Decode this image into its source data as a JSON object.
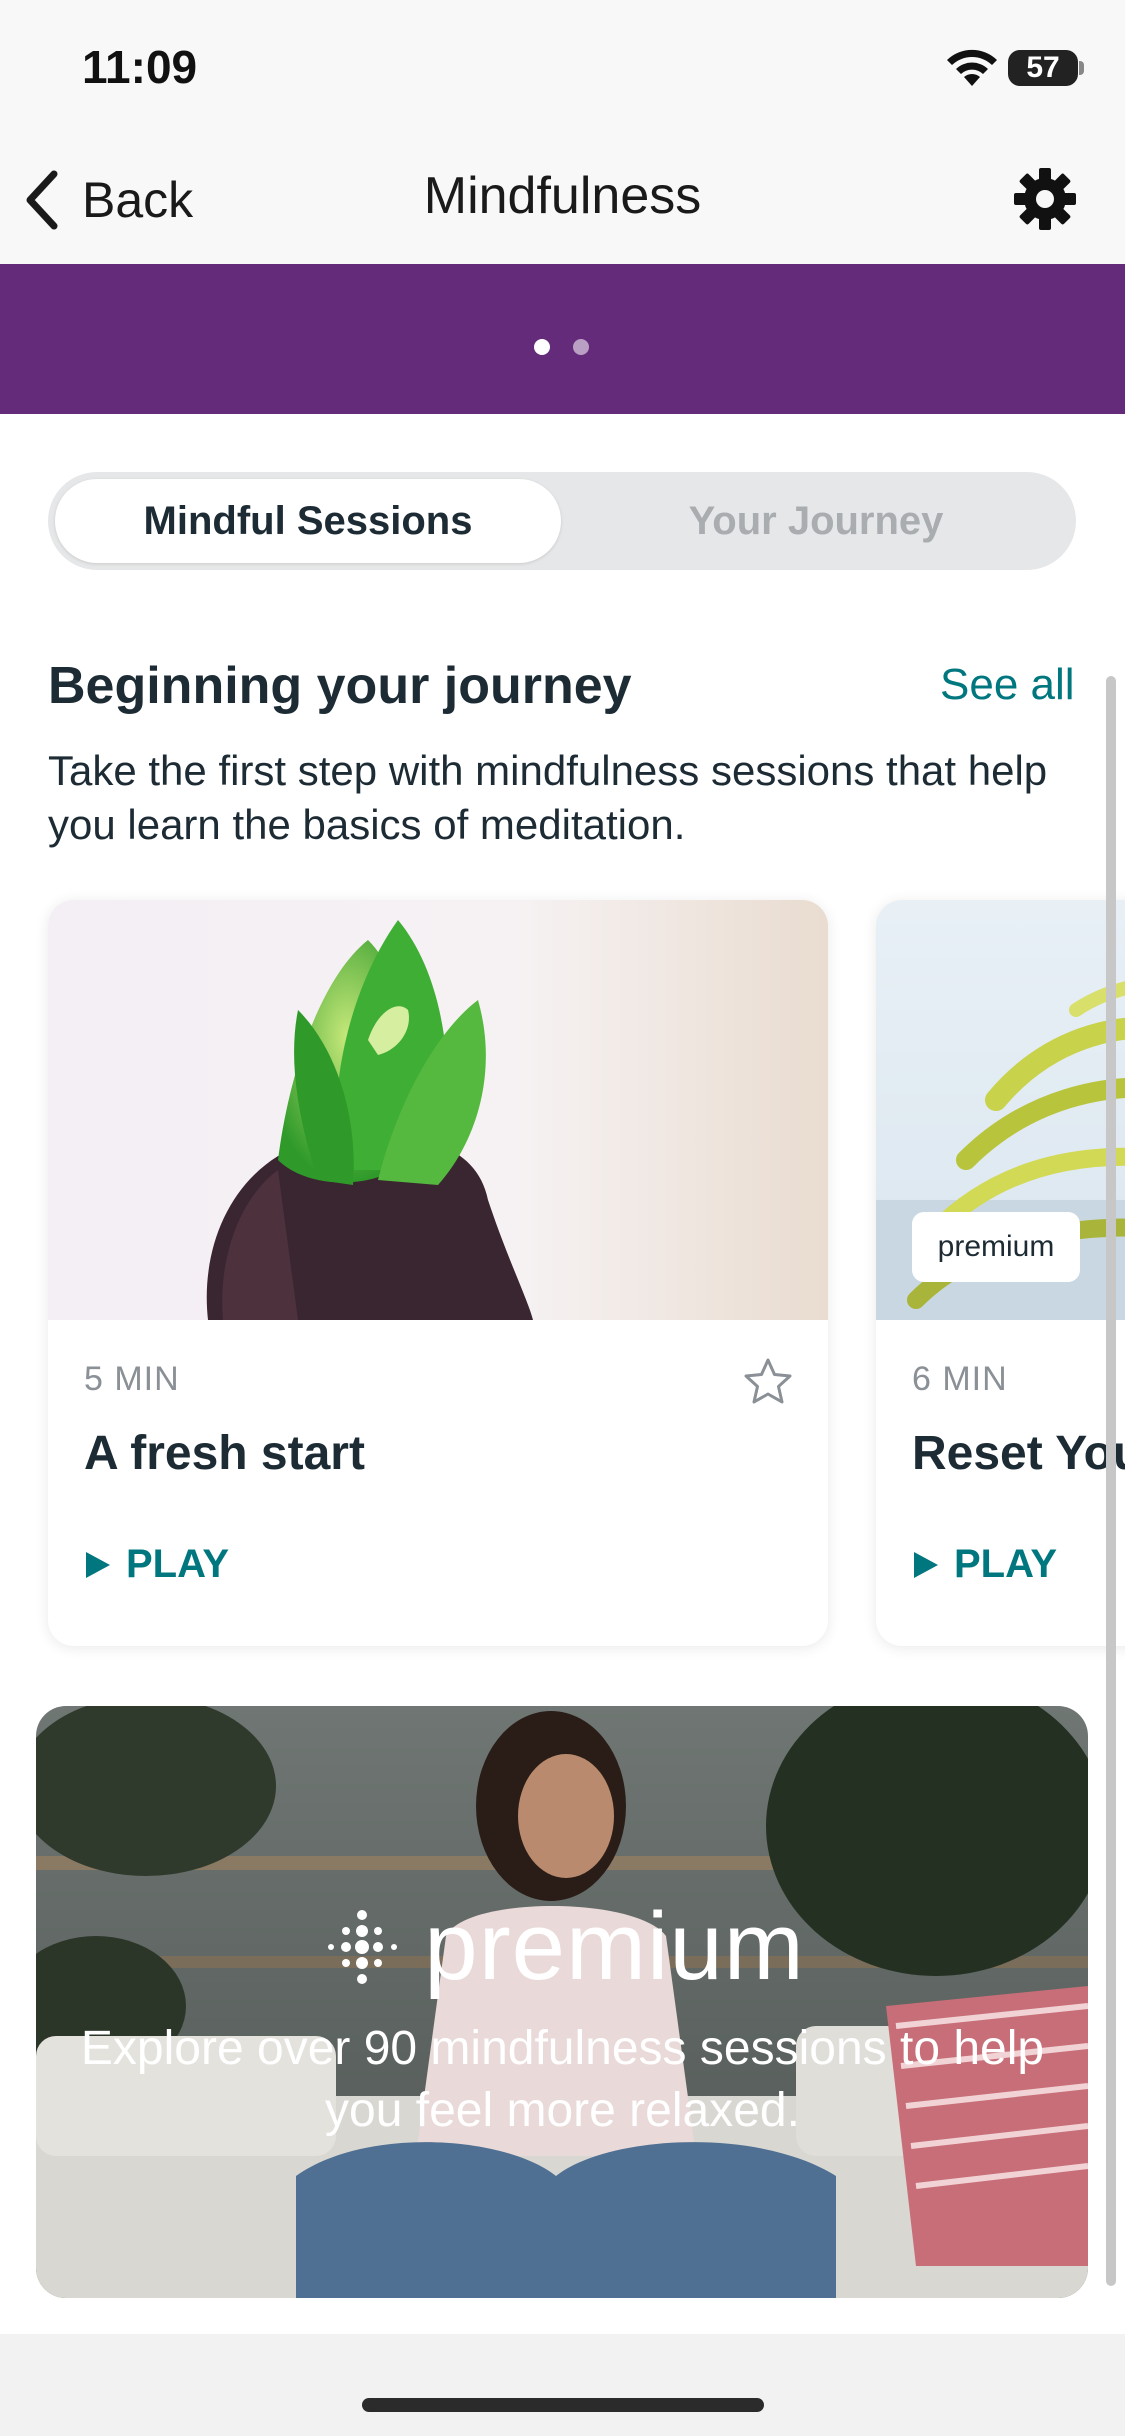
{
  "status_bar": {
    "time": "11:09",
    "battery": "57"
  },
  "nav": {
    "back_label": "Back",
    "title": "Mindfulness",
    "settings_icon": "gear-icon"
  },
  "banner": {
    "color": "#642b7a",
    "pages": 2,
    "active_page": 1
  },
  "segments": {
    "active": "Mindful Sessions",
    "inactive": "Your Journey"
  },
  "section": {
    "title": "Beginning your journey",
    "see_all": "See all",
    "description": "Take the first step with mindfulness sessions that help you learn the basics of meditation."
  },
  "cards": [
    {
      "duration": "5 MIN",
      "title": "A fresh start",
      "play": "PLAY",
      "favorite_icon": "star-outline-icon"
    },
    {
      "duration": "6 MIN",
      "title": "Reset Your",
      "play": "PLAY",
      "tag": "premium"
    }
  ],
  "promo": {
    "brand": "premium",
    "text": "Explore over 90 mindfulness sessions to help you feel more relaxed."
  },
  "colors": {
    "accent": "#00777f",
    "text": "#1d2b34"
  }
}
